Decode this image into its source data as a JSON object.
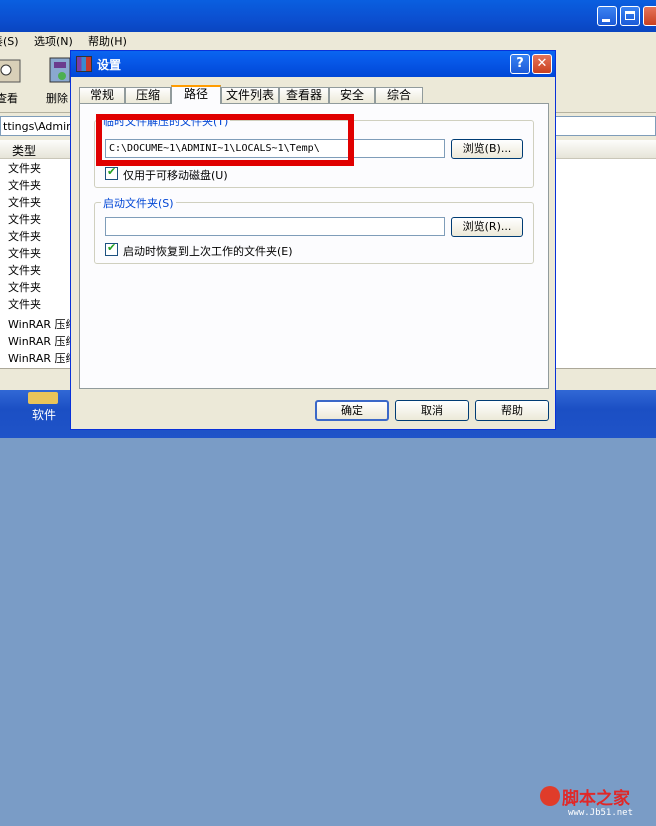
{
  "background": {
    "menu": [
      "奏(S)",
      "选项(N)",
      "帮助(H)"
    ],
    "toolbar": [
      "查看",
      "删除"
    ],
    "address": "ttings\\Admini",
    "list_header": "类型",
    "rows": [
      "文件夹",
      "文件夹",
      "文件夹",
      "文件夹",
      "文件夹",
      "文件夹",
      "文件夹",
      "文件夹",
      "文件夹",
      "WinRAR 压缩",
      "WinRAR 压缩",
      "WinRAR 压缩"
    ]
  },
  "taskbar": {
    "item": "软件"
  },
  "watermark": {
    "text": "脚本之家",
    "url": "www.Jb51.net"
  },
  "dialog": {
    "title": "设置",
    "help_label": "?",
    "close_label": "✕",
    "tabs": [
      "常规",
      "压缩",
      "路径",
      "文件列表",
      "查看器",
      "安全",
      "综合"
    ],
    "active_tab": "路径",
    "temp_group": {
      "title": "临时文件解压的文件夹(T)",
      "path": "C:\\DOCUME~1\\ADMINI~1\\LOCALS~1\\Temp\\",
      "browse": "浏览(B)...",
      "checkbox": "仅用于可移动磁盘(U)",
      "checked": true
    },
    "start_group": {
      "title": "启动文件夹(S)",
      "path": "",
      "browse": "浏览(R)...",
      "checkbox": "启动时恢复到上次工作的文件夹(E)",
      "checked": true
    },
    "buttons": {
      "ok": "确定",
      "cancel": "取消",
      "help": "帮助"
    }
  },
  "colors": {
    "highlight": "#e00000",
    "group_title": "#0046d5"
  }
}
